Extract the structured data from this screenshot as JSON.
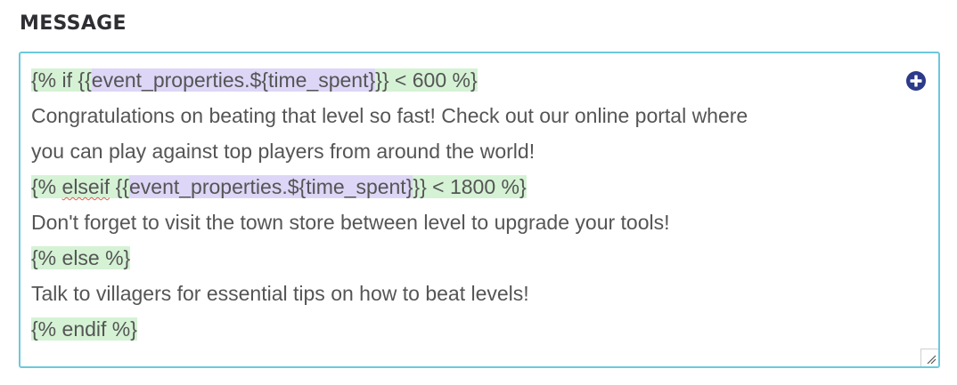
{
  "field": {
    "label": "MESSAGE"
  },
  "editor": {
    "line1": {
      "tag_open": "{% if {{",
      "var": "event_properties.${time_spent}",
      "tag_close": "}} < 600 %}"
    },
    "line2": "Congratulations on beating that level so fast! Check out our online portal where",
    "line3": "you can play against top players from around the world!",
    "line4": {
      "tag_open_a": "{% ",
      "keyword": "elseif",
      "tag_open_b": " {{",
      "var": "event_properties.${time_spent}",
      "tag_close": "}} < 1800 %}"
    },
    "line5": "Don't forget to visit the town store between level to upgrade your tools!",
    "line6": "{% else %}",
    "line7": "Talk to villagers for essential tips on how to beat levels!",
    "line8": "{% endif %}"
  },
  "icons": {
    "add": "plus-circle-icon",
    "resize": "resize-handle-icon"
  },
  "colors": {
    "border": "#6cc8dc",
    "tag_highlight": "#d5f2d5",
    "variable_highlight": "#ddd6f6",
    "add_icon": "#2c3a8a",
    "text": "#555555",
    "label": "#2f2f33"
  }
}
